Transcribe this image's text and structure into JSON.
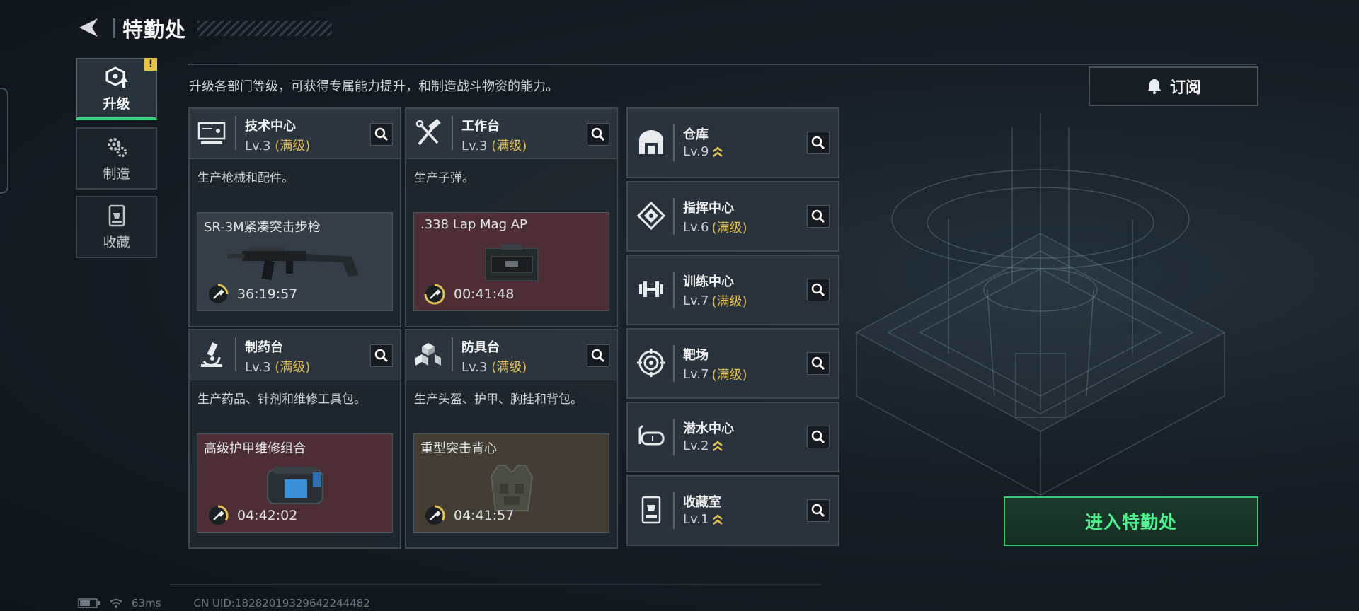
{
  "header": {
    "title": "特勤处"
  },
  "nav": {
    "items": [
      {
        "label": "升级",
        "icon": "upgrade-icon",
        "active": true,
        "badge": "!"
      },
      {
        "label": "制造",
        "icon": "gears-icon",
        "active": false
      },
      {
        "label": "收藏",
        "icon": "collection-icon",
        "active": false
      }
    ]
  },
  "description": "升级各部门等级，可获得专属能力提升，和制造战斗物资的能力。",
  "subscribe": {
    "label": "订阅",
    "icon": "bell-icon"
  },
  "facilities": [
    {
      "name": "技术中心",
      "level": "Lv.3",
      "status": "(满级)",
      "desc": "生产枪械和配件。",
      "product": {
        "name": "SR-3M紧凑突击步枪",
        "timer": "36:19:57",
        "tone": "gray",
        "image": "rifle-icon"
      }
    },
    {
      "name": "工作台",
      "level": "Lv.3",
      "status": "(满级)",
      "desc": "生产子弹。",
      "product": {
        "name": ".338 Lap Mag AP",
        "timer": "00:41:48",
        "tone": "red",
        "image": "ammo-box-icon"
      }
    },
    {
      "name": "制药台",
      "level": "Lv.3",
      "status": "(满级)",
      "desc": "生产药品、针剂和维修工具包。",
      "product": {
        "name": "高级护甲维修组合",
        "timer": "04:42:02",
        "tone": "red",
        "image": "repair-kit-icon"
      }
    },
    {
      "name": "防具台",
      "level": "Lv.3",
      "status": "(满级)",
      "desc": "生产头盔、护甲、胸挂和背包。",
      "product": {
        "name": "重型突击背心",
        "timer": "04:41:57",
        "tone": "brown",
        "image": "vest-icon"
      }
    }
  ],
  "rooms": [
    {
      "name": "仓库",
      "level": "Lv.9",
      "status": "",
      "upgrade": true,
      "icon": "warehouse-icon"
    },
    {
      "name": "指挥中心",
      "level": "Lv.6",
      "status": "(满级)",
      "upgrade": false,
      "icon": "command-center-icon"
    },
    {
      "name": "训练中心",
      "level": "Lv.7",
      "status": "(满级)",
      "upgrade": false,
      "icon": "dumbbell-icon"
    },
    {
      "name": "靶场",
      "level": "Lv.7",
      "status": "(满级)",
      "upgrade": false,
      "icon": "target-icon"
    },
    {
      "name": "潜水中心",
      "level": "Lv.2",
      "status": "",
      "upgrade": true,
      "icon": "diving-mask-icon"
    },
    {
      "name": "收藏室",
      "level": "Lv.1",
      "status": "",
      "upgrade": true,
      "icon": "collection-room-icon"
    }
  ],
  "enter_button": {
    "label": "进入特勤处"
  },
  "status_bar": {
    "ping": "63ms",
    "uid": "CN UID:18282019329642244482"
  },
  "colors": {
    "accent_green": "#35d07a",
    "max_level_gold": "#e2c156",
    "upgrade_arrow": "#e2c156"
  }
}
